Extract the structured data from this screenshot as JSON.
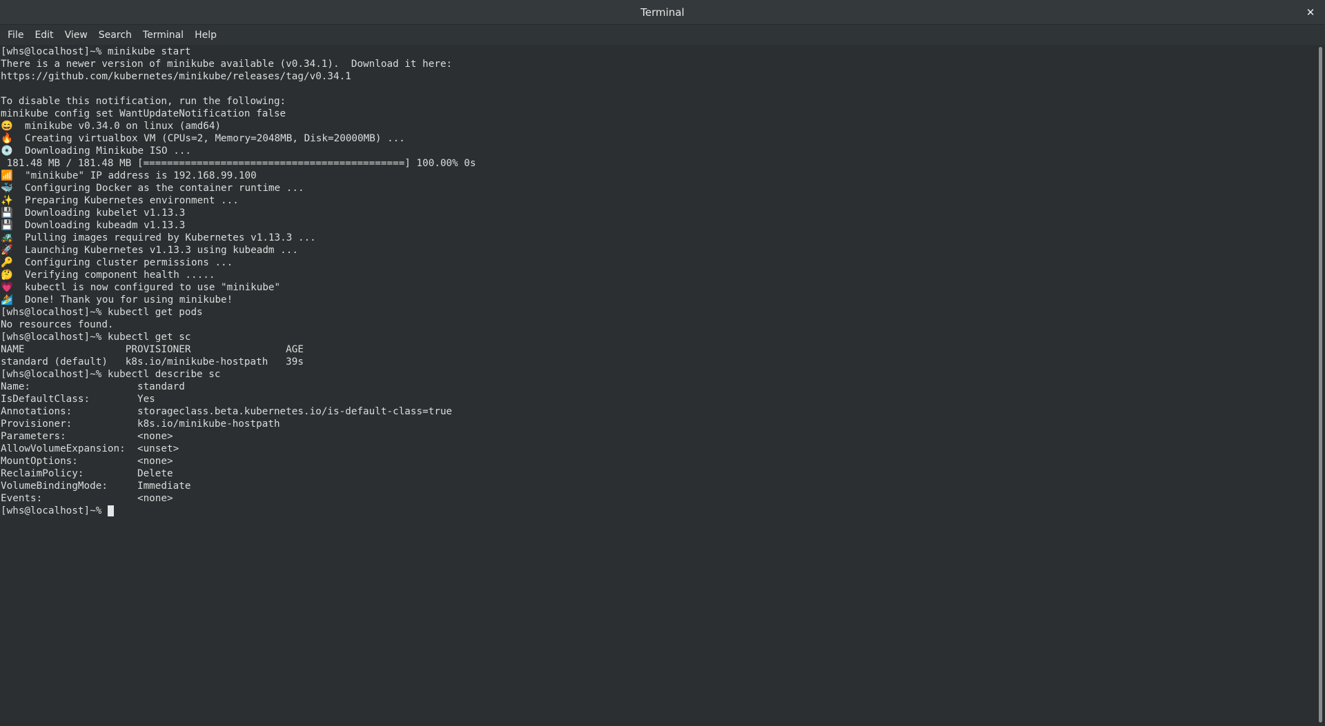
{
  "window": {
    "title": "Terminal",
    "close_label": "✕"
  },
  "menu": [
    "File",
    "Edit",
    "View",
    "Search",
    "Terminal",
    "Help"
  ],
  "terminal": {
    "lines": [
      "[whs@localhost]~% minikube start",
      "There is a newer version of minikube available (v0.34.1).  Download it here:",
      "https://github.com/kubernetes/minikube/releases/tag/v0.34.1",
      "",
      "To disable this notification, run the following:",
      "minikube config set WantUpdateNotification false",
      "😄  minikube v0.34.0 on linux (amd64)",
      "🔥  Creating virtualbox VM (CPUs=2, Memory=2048MB, Disk=20000MB) ...",
      "💿  Downloading Minikube ISO ...",
      " 181.48 MB / 181.48 MB [============================================] 100.00% 0s",
      "📶  \"minikube\" IP address is 192.168.99.100",
      "🐳  Configuring Docker as the container runtime ...",
      "✨  Preparing Kubernetes environment ...",
      "💾  Downloading kubelet v1.13.3",
      "💾  Downloading kubeadm v1.13.3",
      "🚜  Pulling images required by Kubernetes v1.13.3 ...",
      "🚀  Launching Kubernetes v1.13.3 using kubeadm ...",
      "🔑  Configuring cluster permissions ...",
      "🤔  Verifying component health .....",
      "💗  kubectl is now configured to use \"minikube\"",
      "🏄  Done! Thank you for using minikube!",
      "[whs@localhost]~% kubectl get pods",
      "No resources found.",
      "[whs@localhost]~% kubectl get sc",
      "NAME                 PROVISIONER                AGE",
      "standard (default)   k8s.io/minikube-hostpath   39s",
      "[whs@localhost]~% kubectl describe sc",
      "Name:                  standard",
      "IsDefaultClass:        Yes",
      "Annotations:           storageclass.beta.kubernetes.io/is-default-class=true",
      "Provisioner:           k8s.io/minikube-hostpath",
      "Parameters:            <none>",
      "AllowVolumeExpansion:  <unset>",
      "MountOptions:          <none>",
      "ReclaimPolicy:         Delete",
      "VolumeBindingMode:     Immediate",
      "Events:                <none>"
    ],
    "prompt": "[whs@localhost]~% "
  }
}
